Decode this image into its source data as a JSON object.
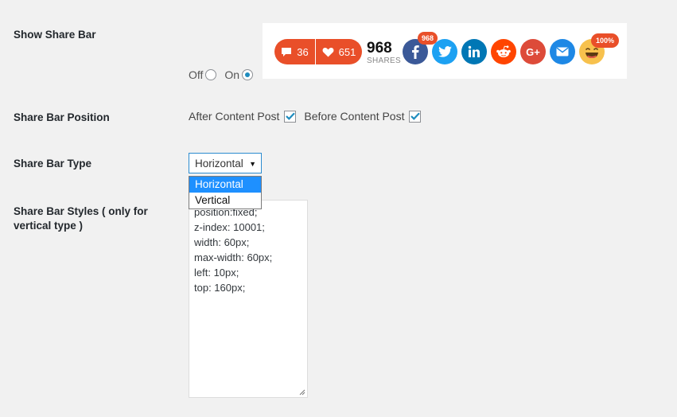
{
  "labels": {
    "show_share_bar": "Show Share Bar",
    "share_bar_position": "Share Bar Position",
    "share_bar_type": "Share Bar Type",
    "share_bar_styles": "Share Bar Styles ( only for vertical type )"
  },
  "preview": {
    "comments_count": "36",
    "love_count": "651",
    "total_shares": "968",
    "shares_label": "SHARES",
    "facebook_badge": "968",
    "emoji_badge": "100%",
    "google_plus_glyph": "G+",
    "icons": [
      "comment-icon",
      "heart-icon",
      "facebook-icon",
      "twitter-icon",
      "linkedin-icon",
      "reddit-icon",
      "google-plus-icon",
      "email-icon",
      "laughing-emoji-icon"
    ],
    "colors": {
      "accent_red": "#e94f29",
      "facebook": "#3b5998",
      "twitter": "#1da1f2",
      "linkedin": "#0077b5",
      "reddit": "#ff4500",
      "google_plus": "#dd4b39",
      "email": "#1e88e5"
    }
  },
  "show_toggle": {
    "off_label": "Off",
    "on_label": "On",
    "selected": "On"
  },
  "position": {
    "after_label": "After Content Post",
    "after_checked": true,
    "before_label": "Before Content Post",
    "before_checked": true
  },
  "type_select": {
    "value": "Horizontal",
    "options": [
      "Horizontal",
      "Vertical"
    ],
    "highlighted": "Horizontal"
  },
  "styles_textarea": {
    "lines": [
      "position:fixed;",
      "z-index: 10001;",
      "width: 60px;",
      "max-width: 60px;",
      "left: 10px;",
      "top: 160px;"
    ]
  }
}
